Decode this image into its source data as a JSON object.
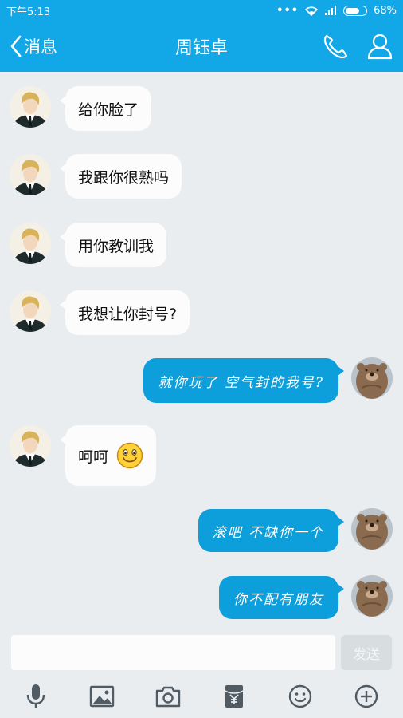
{
  "status_bar": {
    "time": "下午5:13",
    "dots": "•••",
    "battery": "68%"
  },
  "nav": {
    "back_label": "消息",
    "title": "周钰卓"
  },
  "messages": [
    {
      "side": "left",
      "text": "给你脸了"
    },
    {
      "side": "left",
      "text": "我跟你很熟吗"
    },
    {
      "side": "left",
      "text": "用你教训我"
    },
    {
      "side": "left",
      "text": "我想让你封号?"
    },
    {
      "side": "right",
      "text": "就你玩了 空气封的我号?"
    },
    {
      "side": "left",
      "text": "呵呵",
      "emoji": "smiley-icon"
    },
    {
      "side": "right",
      "text": "滚吧 不缺你一个"
    },
    {
      "side": "right",
      "text": "你不配有朋友"
    }
  ],
  "input": {
    "value": "",
    "placeholder": "",
    "send_label": "发送"
  },
  "toolbar": [
    "microphone-icon",
    "image-icon",
    "camera-icon",
    "red-packet-icon",
    "emoji-icon",
    "plus-icon"
  ],
  "colors": {
    "brand": "#12a8e8",
    "outgoing_bubble": "#0d9fdb",
    "incoming_bubble": "#fbfcfb",
    "background": "#e9edf0"
  }
}
